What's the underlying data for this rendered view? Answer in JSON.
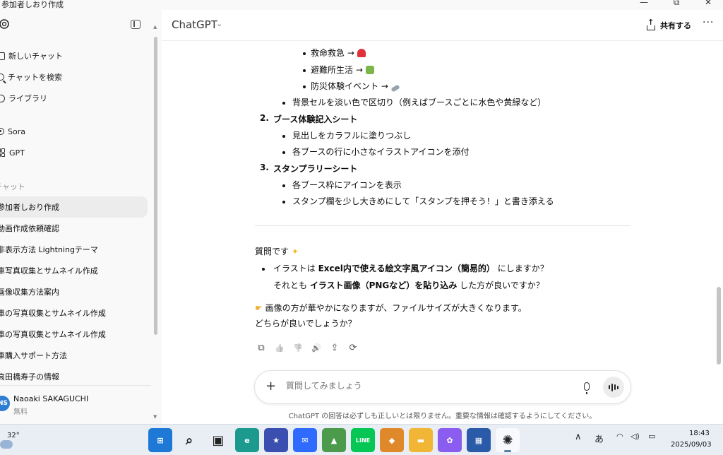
{
  "window": {
    "title": "参加者しおり作成",
    "minimize": "—",
    "restore": "⧉",
    "close": "✕"
  },
  "sidebar": {
    "nav": [
      {
        "label": "新しいチャット",
        "icon": "new-chat-icon"
      },
      {
        "label": "チャットを検索",
        "icon": "search-icon"
      },
      {
        "label": "ライブラリ",
        "icon": "library-icon"
      },
      {
        "label": "Sora",
        "icon": "sora-icon"
      },
      {
        "label": "GPT",
        "icon": "gpt-grid-icon"
      }
    ],
    "section_label": "チャット",
    "chats": [
      "参加者しおり作成",
      "動画作成依頼確認",
      "非表示方法 Lightningテーマ",
      "車写真収集とサムネイル作成",
      "画像収集方法案内",
      "車の写真収集とサムネイル作成",
      "車の写真収集とサムネイル作成",
      "車購入サポート方法",
      "高田橋寿子の情報"
    ],
    "user": {
      "initials": "NS",
      "name": "Naoaki SAKAGUCHI",
      "plan": "無料"
    }
  },
  "header": {
    "model": "ChatGPT",
    "caret": "⌄",
    "share_label": "共有する",
    "more": "···"
  },
  "message": {
    "sub_items": [
      {
        "text": "救命救急 →",
        "emoji": "rescue-helmet-emoji",
        "emoji_color": "#e0303a"
      },
      {
        "text": "避難所生活 →",
        "emoji": "tent-camp-emoji",
        "emoji_color": "#7ab648"
      },
      {
        "text": "防災体験イベント →",
        "emoji": "flashlight-emoji",
        "emoji_color": "#9aa4b0"
      }
    ],
    "bg_cell_note": "背景セルを淡い色で区切り（例えばブースごとに水色や黄緑など）",
    "section2": {
      "num": "2.",
      "title": "ブース体験記入シート"
    },
    "section2_items": [
      "見出しをカラフルに塗りつぶし",
      "各ブースの行に小さなイラストアイコンを添付"
    ],
    "section3": {
      "num": "3.",
      "title": "スタンプラリーシート"
    },
    "section3_items": [
      "各ブース枠にアイコンを表示",
      "スタンプ欄を少し大きめにして「スタンプを押そう！」と書き添える"
    ],
    "question_intro": "質問です",
    "question_intro_emoji": "sparkles-emoji",
    "q_line1": {
      "pre": "イラストは ",
      "bold": "Excel内で使える絵文字風アイコン（簡易的）",
      "post": " にしますか？"
    },
    "q_line2": {
      "pre": "それとも ",
      "bold": "イラスト画像（PNGなど）を貼り込み",
      "post": " した方が良いですか？"
    },
    "note_line": "画像の方が華やかになりますが、ファイルサイズが大きくなります。",
    "note_emoji": "pointing-hand-emoji",
    "final_line": "どちらが良いでしょうか？"
  },
  "actions": [
    {
      "name": "copy-icon",
      "glyph": "⧉"
    },
    {
      "name": "thumbs-up-icon",
      "glyph": "👍"
    },
    {
      "name": "thumbs-down-icon",
      "glyph": "👎"
    },
    {
      "name": "read-aloud-icon",
      "glyph": "🔊"
    },
    {
      "name": "share-icon",
      "glyph": "⇪"
    },
    {
      "name": "regenerate-icon",
      "glyph": "⟳"
    }
  ],
  "composer": {
    "placeholder": "質問してみましょう",
    "plus": "+"
  },
  "disclaimer": "ChatGPT の回答は必ずしも正しいとは限りません。重要な情報は確認するようにしてください。",
  "taskbar": {
    "weather_temp": "32°",
    "apps": [
      {
        "name": "start-icon",
        "color": "#1e78d6",
        "glyph": "⊞"
      },
      {
        "name": "search-icon",
        "color": "transparent",
        "glyph": "⌕"
      },
      {
        "name": "task-view-icon",
        "color": "transparent",
        "glyph": "▣"
      },
      {
        "name": "edge-icon",
        "color": "#1c9a8e",
        "glyph": "e"
      },
      {
        "name": "game-app-icon",
        "color": "#3a4fb0",
        "glyph": "★"
      },
      {
        "name": "messenger-icon",
        "color": "#2f6bff",
        "glyph": "✉"
      },
      {
        "name": "photo-app-icon",
        "color": "#4c9a4c",
        "glyph": "▲"
      },
      {
        "name": "line-icon",
        "color": "#06c755",
        "glyph": "LINE"
      },
      {
        "name": "orange-app-icon",
        "color": "#e0892b",
        "glyph": "◆"
      },
      {
        "name": "file-explorer-icon",
        "color": "#f2b636",
        "glyph": "▬"
      },
      {
        "name": "copilot-icon",
        "color": "#8a5cf0",
        "glyph": "✿"
      },
      {
        "name": "store-icon",
        "color": "#2a5aa8",
        "glyph": "▦"
      },
      {
        "name": "chatgpt-taskbar-icon",
        "color": "transparent",
        "glyph": "✺"
      }
    ],
    "tray_chevron": "∧",
    "ime": "あ",
    "time": "18:43",
    "date": "2025/09/03"
  }
}
